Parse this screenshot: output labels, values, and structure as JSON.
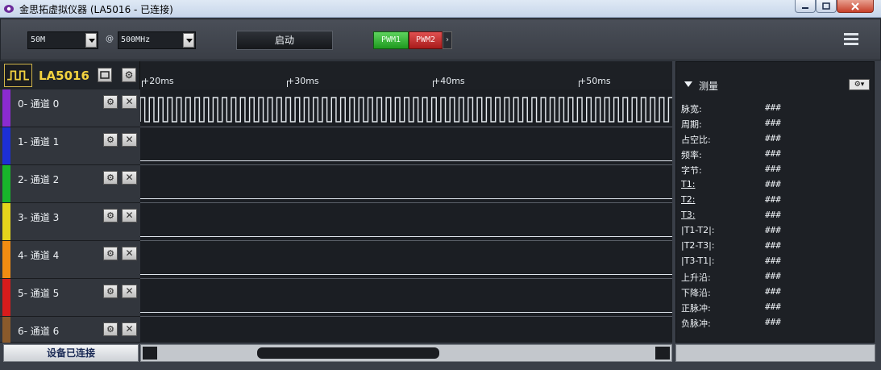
{
  "window": {
    "title": "金思拓虚拟仪器 (LA5016 - 已连接)"
  },
  "toolbar": {
    "samples_value": "50M",
    "at_sign": "@",
    "rate_value": "500MHz",
    "start_label": "启动",
    "pwm1_label": "PWM1",
    "pwm2_label": "PWM2",
    "pwm_more": "›"
  },
  "device": {
    "name": "LA5016"
  },
  "ruler": {
    "ticks": [
      "+20ms",
      "+30ms",
      "+40ms",
      "+50ms"
    ]
  },
  "channels": [
    {
      "label": "0-  通道 0",
      "color": "#8b2bd1"
    },
    {
      "label": "1-  通道 1",
      "color": "#1d2fd6"
    },
    {
      "label": "2-  通道 2",
      "color": "#18b52b"
    },
    {
      "label": "3-  通道 3",
      "color": "#e4d41c"
    },
    {
      "label": "4-  通道 4",
      "color": "#f18c12"
    },
    {
      "label": "5-  通道 5",
      "color": "#d81c1c"
    },
    {
      "label": "6-  通道 6",
      "color": "#8a5a2b"
    }
  ],
  "measure": {
    "title": "测量",
    "options": "⚙▾",
    "rows": [
      {
        "name": "脉宽:",
        "value": "###"
      },
      {
        "name": "周期:",
        "value": "###"
      },
      {
        "name": "占空比:",
        "value": "###"
      },
      {
        "name": "频率:",
        "value": "###"
      },
      {
        "name": "字节:",
        "value": "###"
      },
      {
        "name": "T1:",
        "value": "###"
      },
      {
        "name": "T2:",
        "value": "###"
      },
      {
        "name": "T3:",
        "value": "###"
      },
      {
        "name": "|T1-T2|:",
        "value": "###"
      },
      {
        "name": "|T2-T3|:",
        "value": "###"
      },
      {
        "name": "|T3-T1|:",
        "value": "###"
      },
      {
        "name": "上升沿:",
        "value": "###"
      },
      {
        "name": "下降沿:",
        "value": "###"
      },
      {
        "name": "正脉冲:",
        "value": "###"
      },
      {
        "name": "负脉冲:",
        "value": "###"
      }
    ]
  },
  "status": {
    "connection": "设备已连接"
  }
}
